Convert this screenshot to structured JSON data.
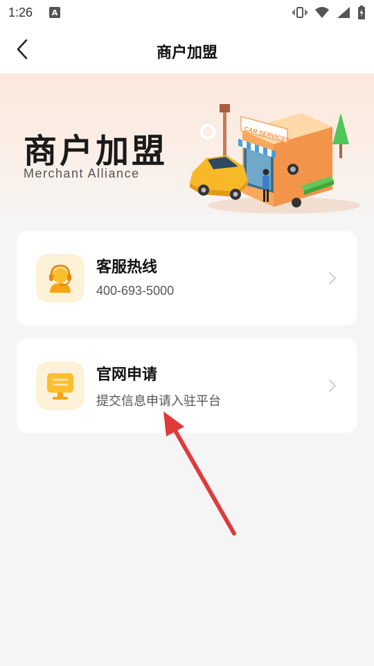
{
  "status_bar": {
    "time": "1:26",
    "indicator_letter": "A",
    "icons": [
      "vibrate-icon",
      "wifi-icon",
      "signal-icon",
      "battery-charging-icon"
    ]
  },
  "nav": {
    "title": "商户加盟",
    "back_icon": "chevron-left-icon"
  },
  "banner": {
    "title": "商户加盟",
    "subtitle": "Merchant Alliance",
    "sign_text": "CAR SERVICES",
    "illustration": "car-service-shop-illustration"
  },
  "cards": [
    {
      "title": "客服热线",
      "subtitle": "400-693-5000",
      "icon": "customer-service-headset-icon"
    },
    {
      "title": "官网申请",
      "subtitle": "提交信息申请入驻平台",
      "icon": "monitor-icon"
    }
  ],
  "colors": {
    "accent_yellow": "#f7b928",
    "icon_bg": "#fdf2d8",
    "annotation_red": "#e03a3a"
  }
}
